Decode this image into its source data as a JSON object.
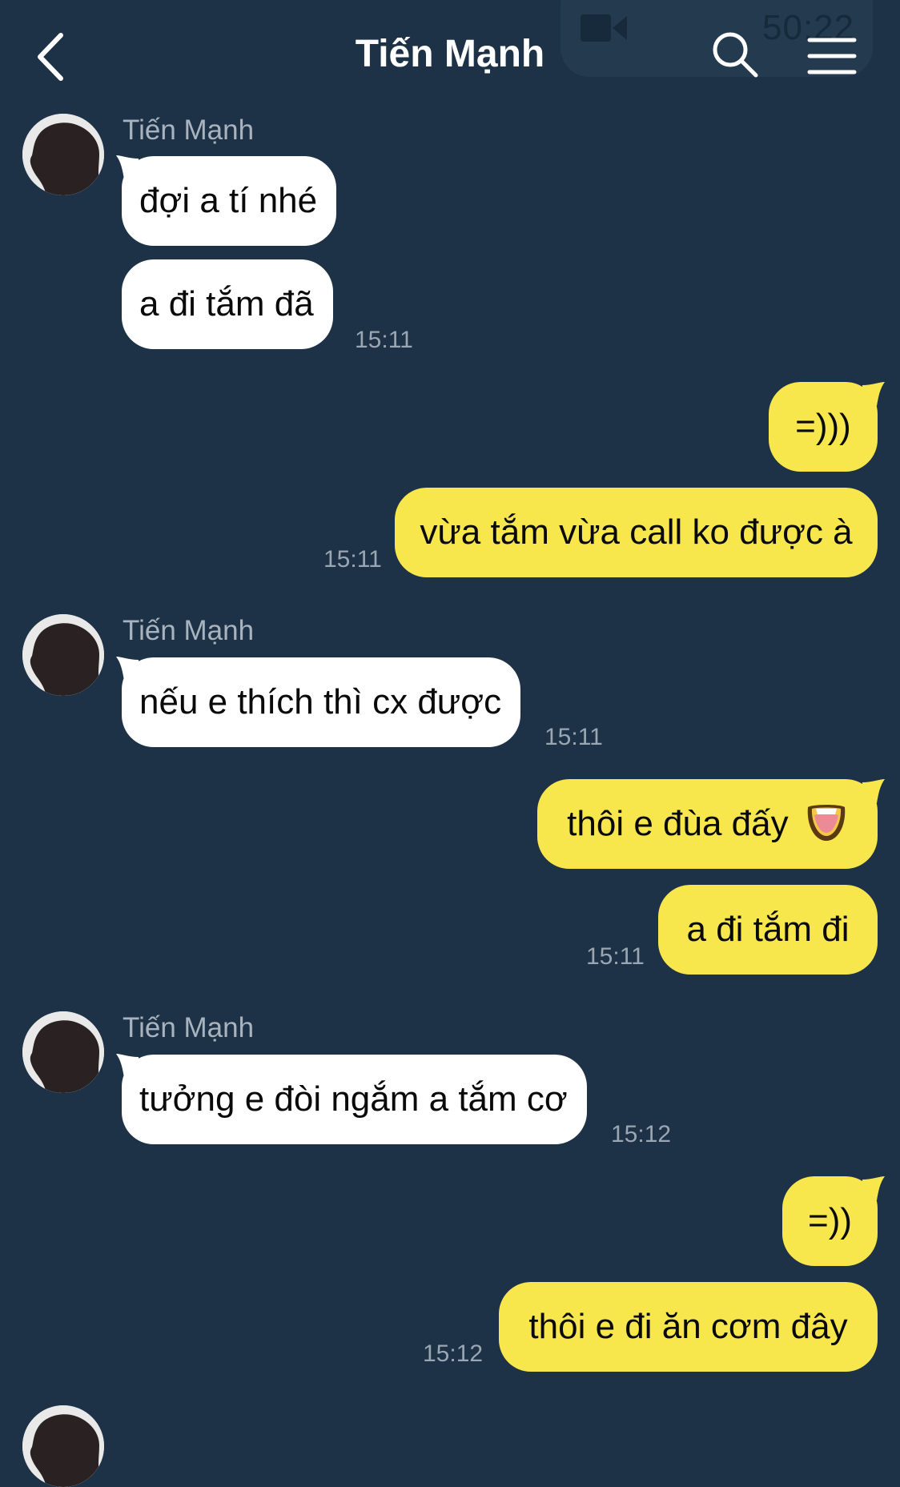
{
  "header": {
    "title": "Tiến Mạnh",
    "call_timer": "50:22",
    "icons": {
      "back": "chevron-left-icon",
      "search": "search-icon",
      "menu": "hamburger-menu-icon",
      "call": "video-camera-icon"
    }
  },
  "colors": {
    "background": "#1d3246",
    "incoming_bubble": "#ffffff",
    "outgoing_bubble": "#f7e74d",
    "timestamp": "#9aa6b2",
    "sender_name": "#a8b3bf"
  },
  "messages": {
    "g1": {
      "sender": "Tiến Mạnh",
      "m1": "đợi a tí nhé",
      "m2": "a đi tắm đã",
      "time": "15:11"
    },
    "g2": {
      "m1": "=)))",
      "m2": "vừa tắm vừa call ko được à",
      "time": "15:11"
    },
    "g3": {
      "sender": "Tiến Mạnh",
      "m1": "nếu e thích thì cx được",
      "time": "15:11"
    },
    "g4": {
      "m1": "thôi e đùa đấy",
      "m1_emoji": "tongue-face-emoji",
      "m2": "a đi tắm đi",
      "time": "15:11"
    },
    "g5": {
      "sender": "Tiến Mạnh",
      "m1": "tưởng e đòi ngắm a tắm cơ",
      "time": "15:12"
    },
    "g6": {
      "m1": "=))",
      "m2": "thôi e đi ăn cơm đây",
      "time": "15:12"
    }
  }
}
